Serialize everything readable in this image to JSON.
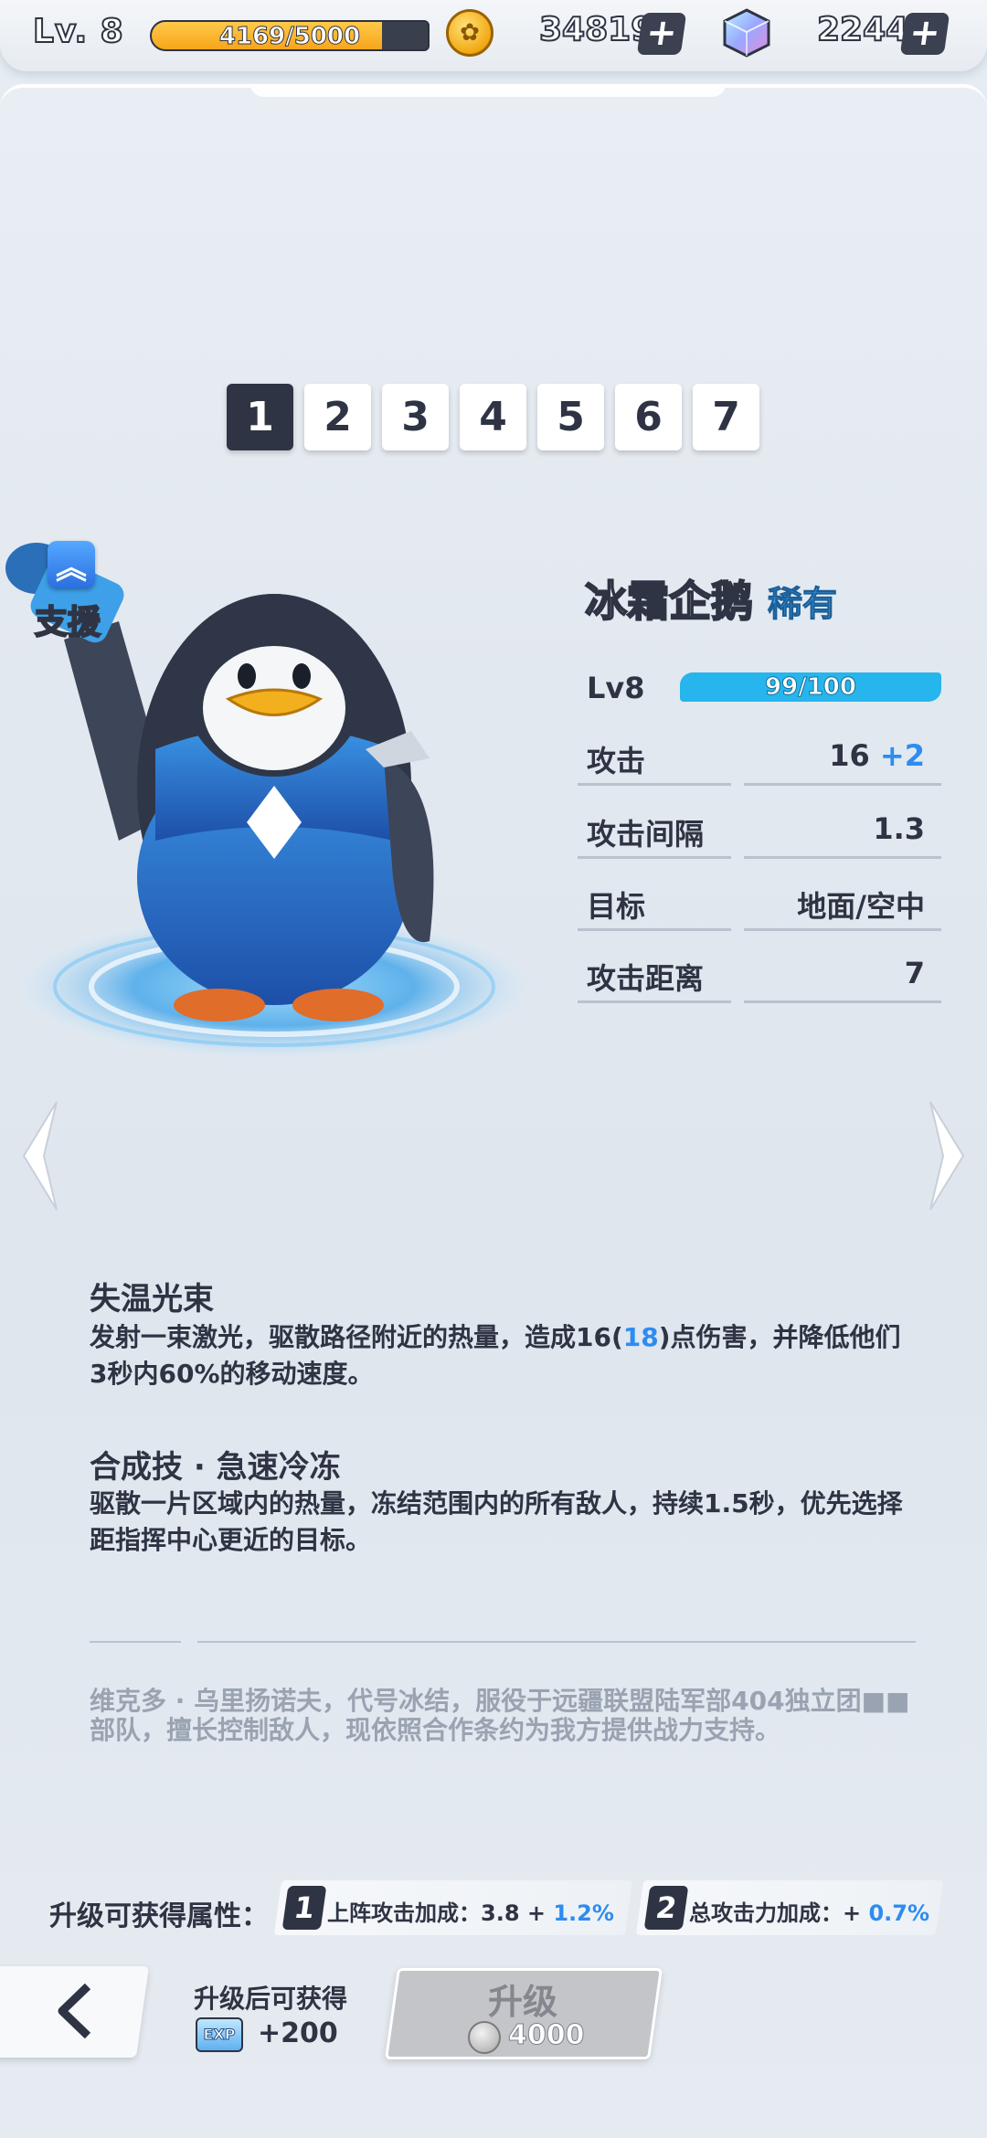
{
  "topbar": {
    "level": "Lv. 8",
    "xp_text": "4169/5000",
    "xp_fraction": 0.834,
    "coins": "34819",
    "coin_icon": "paw-coin-icon",
    "gems": "2244",
    "gem_icon": "crystal-cube-icon"
  },
  "tabs": [
    "1",
    "2",
    "3",
    "4",
    "5",
    "6",
    "7"
  ],
  "active_tab": "1",
  "character": {
    "role": "支援",
    "role_icon": "double-chevron-up-icon",
    "name": "冰霜企鹅",
    "rarity": "稀有",
    "level_label": "Lv8",
    "level_progress_text": "99/100",
    "level_progress": 0.99
  },
  "stats": [
    {
      "name": "攻击",
      "value": "16",
      "bonus": "+2"
    },
    {
      "name": "攻击间隔",
      "value": "1.3",
      "bonus": ""
    },
    {
      "name": "目标",
      "value": "地面/空中",
      "bonus": ""
    },
    {
      "name": "攻击距离",
      "value": "7",
      "bonus": ""
    }
  ],
  "skills": [
    {
      "title": "失温光束",
      "desc_pre": "发射一束激光，驱散路径附近的热量，造成16(",
      "desc_hl": "18",
      "desc_post": ")点伤害，并降低他们3秒内60%的移动速度。"
    },
    {
      "title": "合成技 · 急速冷冻",
      "desc": "驱散一片区域内的热量，冻结范围内的所有敌人，持续1.5秒，优先选择距指挥中心更近的目标。"
    }
  ],
  "lore": "维克多 · 乌里扬诺夫，代号冰结，服役于远疆联盟陆军部404独立团■■部队，擅长控制敌人，现依照合作条约为我方提供战力支持。",
  "upgrade": {
    "label": "升级可获得属性：",
    "attrs": [
      {
        "num": "1",
        "text": "上阵攻击加成：3.8 + ",
        "hl": "1.2%"
      },
      {
        "num": "2",
        "text": "总攻击力加成：+ ",
        "hl": "0.7%"
      }
    ],
    "gain_label": "升级后可获得",
    "exp_badge": "EXP",
    "gain_value": "+200",
    "button_label": "升级",
    "cost": "4000"
  },
  "colors": {
    "accent_blue": "#2d8cf0",
    "dark": "#2f3444",
    "xp_orange": "#f7a51a",
    "level_bar": "#26b5ec"
  }
}
